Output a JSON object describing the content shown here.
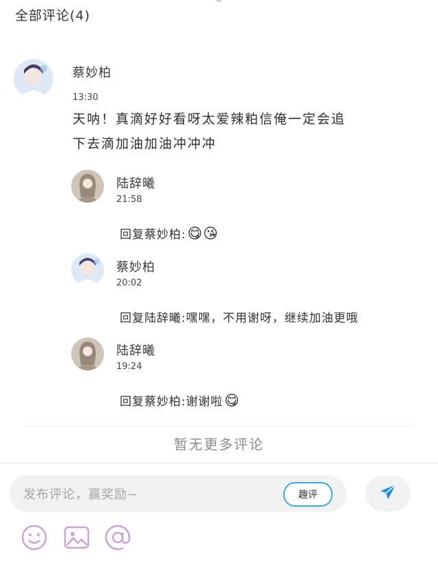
{
  "header": {
    "title": "全部评论(4)"
  },
  "comment": {
    "name": "蔡妙柏",
    "time": "13:30",
    "text_line1": "天呐！真滴好好看呀太爱辣粕信俺一定会追",
    "text_line2": "下去滴加油加油冲冲冲"
  },
  "replies": [
    {
      "name": "陆辞曦",
      "time": "21:58",
      "text": "回复蔡妙柏:",
      "emoji": "😋😘"
    },
    {
      "name": "蔡妙柏",
      "time": "20:02",
      "text": "回复陆辞曦:嘿嘿，不用谢呀，继续加油更哦",
      "emoji": ""
    },
    {
      "name": "陆辞曦",
      "time": "19:24",
      "text": "回复蔡妙柏:谢谢啦",
      "emoji": "😋"
    }
  ],
  "footer": {
    "no_more": "暂无更多评论"
  },
  "composer": {
    "placeholder": "发布评论，赢奖励~",
    "quwen_label": "趣评",
    "send_icon": "paper-plane-icon",
    "icons": [
      "emoji-icon",
      "image-icon",
      "at-icon"
    ]
  },
  "colors": {
    "accent": "#35a8e0",
    "icon_purple": "#c9a3d8"
  }
}
